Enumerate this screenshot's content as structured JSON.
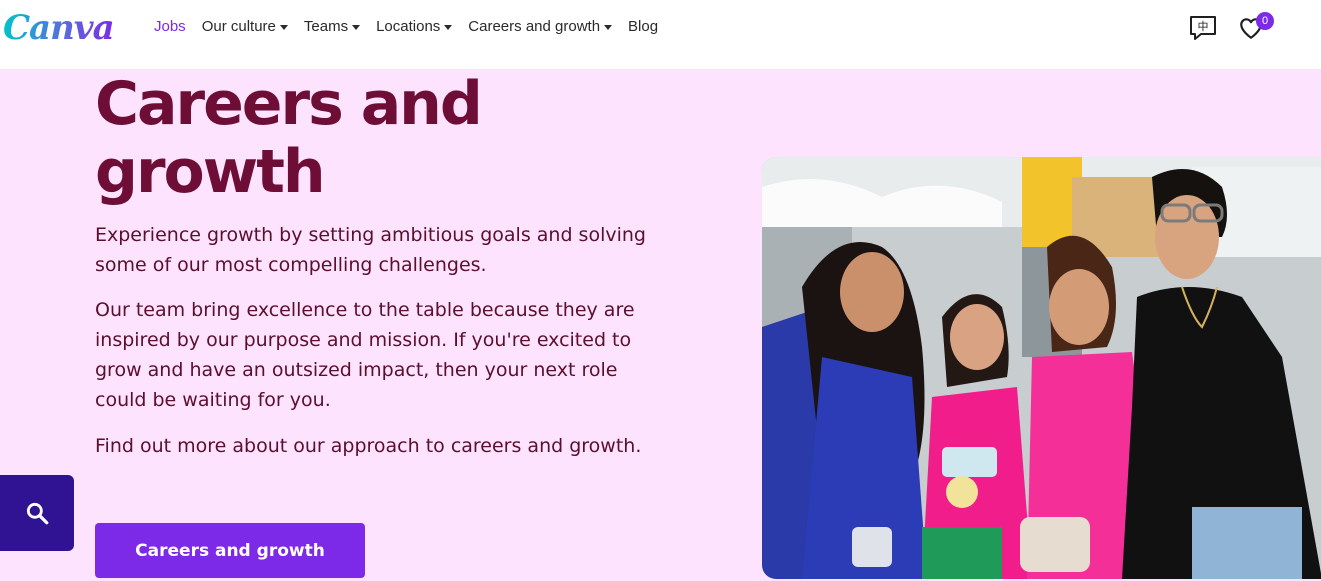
{
  "brand": {
    "logo_text": "Canva"
  },
  "nav": {
    "items": [
      {
        "label": "Jobs",
        "active": true,
        "has_dropdown": false
      },
      {
        "label": "Our culture",
        "active": false,
        "has_dropdown": true
      },
      {
        "label": "Teams",
        "active": false,
        "has_dropdown": true
      },
      {
        "label": "Locations",
        "active": false,
        "has_dropdown": true
      },
      {
        "label": "Careers and growth",
        "active": false,
        "has_dropdown": true
      },
      {
        "label": "Blog",
        "active": false,
        "has_dropdown": false
      }
    ]
  },
  "header_actions": {
    "language_glyph": "中",
    "saved_count": "0"
  },
  "hero": {
    "title_line1": "Careers and",
    "title_line2": "growth",
    "paragraph1": "Experience growth by setting ambitious goals and solving some of our most compelling challenges.",
    "paragraph2": "Our team bring excellence to the table because they are inspired by our purpose and mission. If you're excited to grow and have an outsized impact, then your next role could be waiting for you.",
    "paragraph3": "Find out more about our approach to careers and growth.",
    "cta_label": "Careers and growth"
  },
  "colors": {
    "accent": "#7d2ae8",
    "hero_bg": "#fde3fd",
    "title": "#6e0e36",
    "search_fab": "#2f1392"
  },
  "icons": [
    "language-icon",
    "heart-icon",
    "search-icon",
    "caret-down-icon"
  ]
}
